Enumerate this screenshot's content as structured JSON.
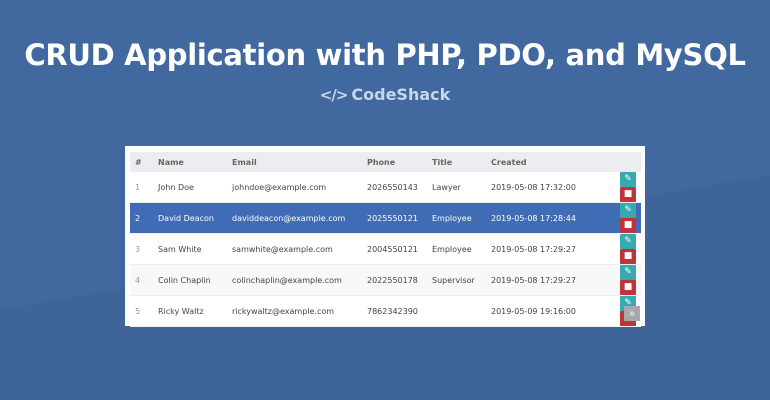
{
  "header": {
    "title": "CRUD Application with PHP, PDO, and MySQL",
    "brand": "CodeShack",
    "brand_icon": "code-icon"
  },
  "colors": {
    "background": "#41699f",
    "selected_row": "#3f6cb4",
    "edit_button": "#38a9b0",
    "delete_button": "#c0333a"
  },
  "table": {
    "columns": [
      "#",
      "Name",
      "Email",
      "Phone",
      "Title",
      "Created"
    ],
    "rows": [
      {
        "id": "1",
        "name": "John Doe",
        "email": "johndoe@example.com",
        "phone": "2026550143",
        "title": "Lawyer",
        "created": "2019-05-08 17:32:00"
      },
      {
        "id": "2",
        "name": "David Deacon",
        "email": "daviddeacon@example.com",
        "phone": "2025550121",
        "title": "Employee",
        "created": "2019-05-08 17:28:44"
      },
      {
        "id": "3",
        "name": "Sam White",
        "email": "samwhite@example.com",
        "phone": "2004550121",
        "title": "Employee",
        "created": "2019-05-08 17:29:27"
      },
      {
        "id": "4",
        "name": "Colin Chaplin",
        "email": "colinchaplin@example.com",
        "phone": "2022550178",
        "title": "Supervisor",
        "created": "2019-05-08 17:29:27"
      },
      {
        "id": "5",
        "name": "Ricky Waltz",
        "email": "rickywaltz@example.com",
        "phone": "7862342390",
        "title": "",
        "created": "2019-05-09 19:16:00"
      }
    ],
    "selected_row": "2",
    "row_actions": {
      "edit_icon": "pencil-icon",
      "delete_icon": "trash-icon"
    }
  },
  "pagination": {
    "next_label": "»",
    "next_icon": "double-chevron-right-icon"
  }
}
